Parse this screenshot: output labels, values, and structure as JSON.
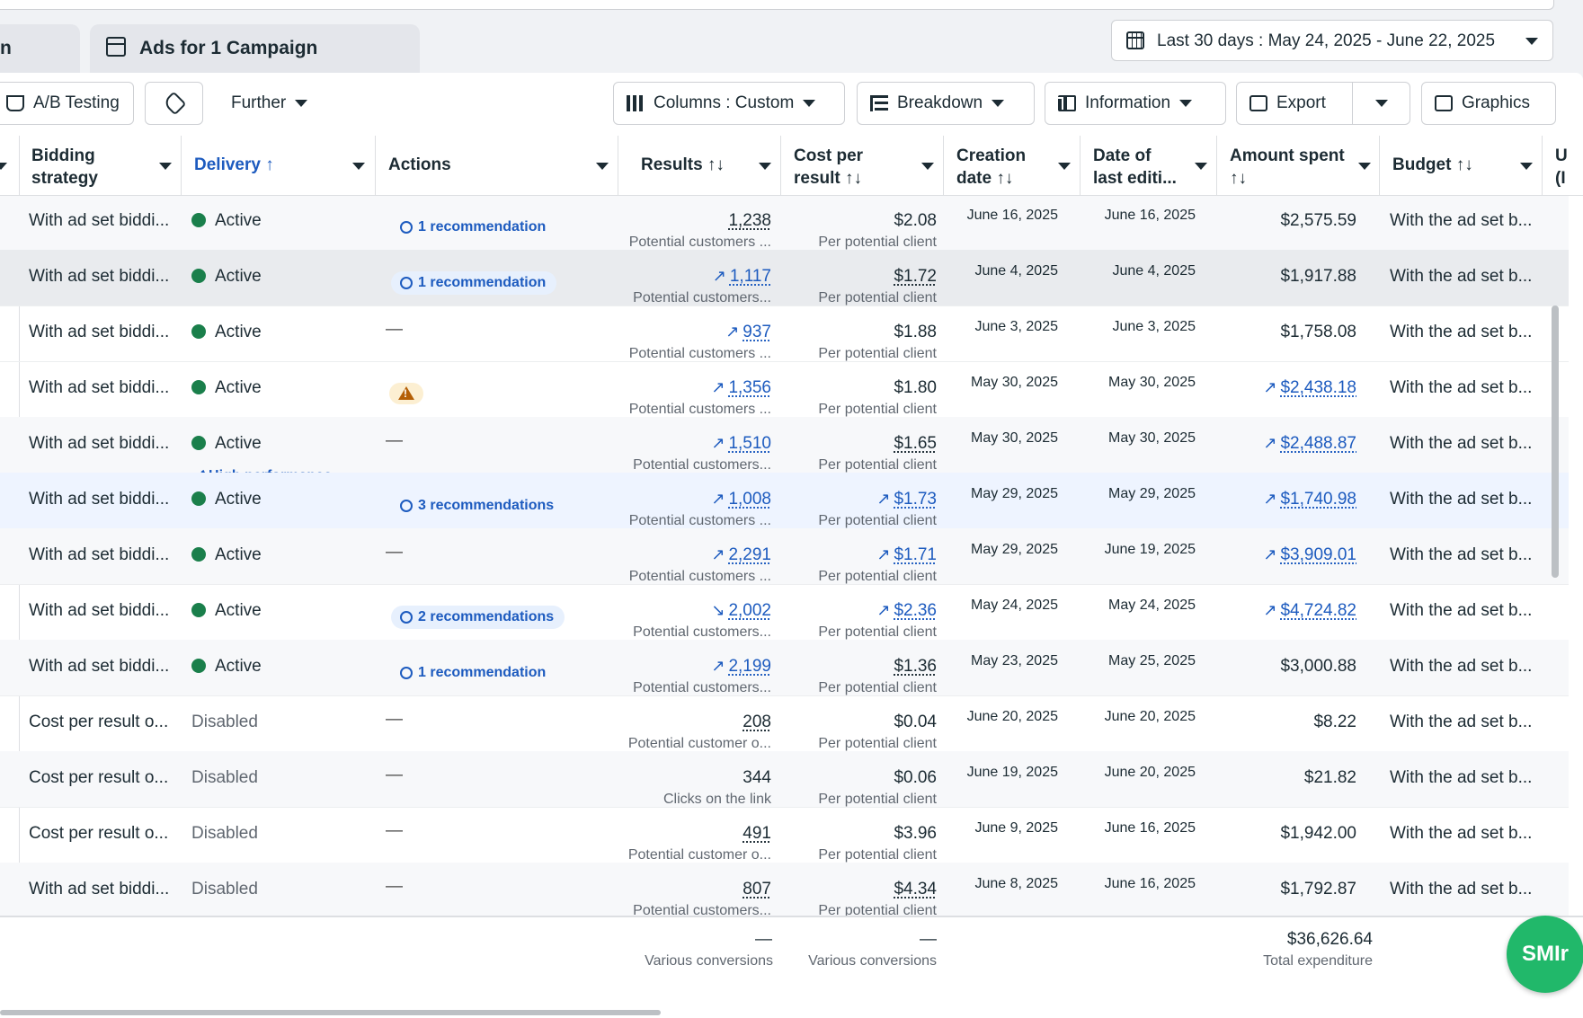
{
  "tabs": {
    "prev_tab_label": "n",
    "current_tab_label": "Ads for 1 Campaign"
  },
  "date_range": {
    "label": "Last 30 days : May 24, 2025 - June 22, 2025"
  },
  "toolbar": {
    "ab_testing": "A/B Testing",
    "further": "Further",
    "columns": "Columns : Custom",
    "breakdown": "Breakdown",
    "information": "Information",
    "export": "Export",
    "graphics": "Graphics"
  },
  "headers": {
    "bidding_1": "Bidding",
    "bidding_2": "strategy",
    "delivery": "Delivery",
    "actions": "Actions",
    "results": "Results",
    "cost_1": "Cost per",
    "cost_2": "result",
    "creation_1": "Creation",
    "creation_2": "date",
    "last_edit_1": "Date of",
    "last_edit_2": "last editi...",
    "amount_1": "Amount spent",
    "budget": "Budget",
    "cut_col": "U (I"
  },
  "rows": [
    {
      "bid": "With ad set biddi...",
      "delivery": "Active",
      "action": "1 recommendation",
      "action_type": "rec",
      "results": "1,238",
      "results_sub": "Potential customers ...",
      "cost": "$2.08",
      "cost_sub": "Per potential client",
      "created": "June 16, 2025",
      "edited": "June 16, 2025",
      "amount": "$2,575.59",
      "budget": "With the ad set b..."
    },
    {
      "bid": "With ad set biddi...",
      "delivery": "Active",
      "action": "1 recommendation",
      "action_type": "rec",
      "results": "1,117",
      "results_sub": "Potential customers...",
      "cost": "$1.72",
      "cost_sub": "Per potential client",
      "created": "June 4, 2025",
      "edited": "June 4, 2025",
      "amount": "$1,917.88",
      "budget": "With the ad set b..."
    },
    {
      "bid": "With ad set biddi...",
      "delivery": "Active",
      "action": "—",
      "action_type": "dash",
      "results": "937",
      "results_sub": "Potential customers ...",
      "cost": "$1.88",
      "cost_sub": "Per potential client",
      "created": "June 3, 2025",
      "edited": "June 3, 2025",
      "amount": "$1,758.08",
      "budget": "With the ad set b..."
    },
    {
      "bid": "With ad set biddi...",
      "delivery": "Active",
      "action": "",
      "action_type": "warn",
      "results": "1,356",
      "results_sub": "Potential customers ...",
      "cost": "$1.80",
      "cost_sub": "Per potential client",
      "created": "May 30, 2025",
      "edited": "May 30, 2025",
      "amount": "$2,438.18",
      "budget": "With the ad set b..."
    },
    {
      "bid": "With ad set biddi...",
      "delivery": "Active",
      "delivery_badge": "High performance",
      "action": "—",
      "action_type": "dash",
      "results": "1,510",
      "results_sub": "Potential customers...",
      "cost": "$1.65",
      "cost_sub": "Per potential client",
      "created": "May 30, 2025",
      "edited": "May 30, 2025",
      "amount": "$2,488.87",
      "budget": "With the ad set b..."
    },
    {
      "bid": "With ad set biddi...",
      "delivery": "Active",
      "action": "3 recommendations",
      "action_type": "rec",
      "results": "1,008",
      "results_sub": "Potential customers ...",
      "cost": "$1.73",
      "cost_sub": "Per potential client",
      "created": "May 29, 2025",
      "edited": "May 29, 2025",
      "amount": "$1,740.98",
      "budget": "With the ad set b..."
    },
    {
      "bid": "With ad set biddi...",
      "delivery": "Active",
      "action": "—",
      "action_type": "dash",
      "results": "2,291",
      "results_sub": "Potential customers ...",
      "cost": "$1.71",
      "cost_sub": "Per potential client",
      "created": "May 29, 2025",
      "edited": "June 19, 2025",
      "amount": "$3,909.01",
      "budget": "With the ad set b..."
    },
    {
      "bid": "With ad set biddi...",
      "delivery": "Active",
      "action": "2 recommendations",
      "action_type": "rec",
      "results": "2,002",
      "results_sub": "Potential customers...",
      "cost": "$2.36",
      "cost_sub": "Per potential client",
      "created": "May 24, 2025",
      "edited": "May 24, 2025",
      "amount": "$4,724.82",
      "budget": "With the ad set b..."
    },
    {
      "bid": "With ad set biddi...",
      "delivery": "Active",
      "action": "1 recommendation",
      "action_type": "rec",
      "results": "2,199",
      "results_sub": "Potential customers...",
      "cost": "$1.36",
      "cost_sub": "Per potential client",
      "created": "May 23, 2025",
      "edited": "May 25, 2025",
      "amount": "$3,000.88",
      "budget": "With the ad set b..."
    },
    {
      "bid": "Cost per result o...",
      "delivery": "Disabled",
      "action": "—",
      "action_type": "dash",
      "results": "208",
      "results_sub": "Potential customer o...",
      "cost": "$0.04",
      "cost_sub": "Per potential client",
      "created": "June 20, 2025",
      "edited": "June 20, 2025",
      "amount": "$8.22",
      "budget": "With the ad set b..."
    },
    {
      "bid": "Cost per result o...",
      "delivery": "Disabled",
      "action": "—",
      "action_type": "dash",
      "results": "344",
      "results_sub": "Clicks on the link",
      "cost": "$0.06",
      "cost_sub": "Per potential client",
      "created": "June 19, 2025",
      "edited": "June 20, 2025",
      "amount": "$21.82",
      "budget": "With the ad set b..."
    },
    {
      "bid": "Cost per result o...",
      "delivery": "Disabled",
      "action": "—",
      "action_type": "dash",
      "results": "491",
      "results_sub": "Potential customer o...",
      "cost": "$3.96",
      "cost_sub": "Per potential client",
      "created": "June 9, 2025",
      "edited": "June 16, 2025",
      "amount": "$1,942.00",
      "budget": "With the ad set b..."
    },
    {
      "bid": "With ad set biddi...",
      "delivery": "Disabled",
      "action": "—",
      "action_type": "dash",
      "results": "807",
      "results_sub": "Potential customers...",
      "cost": "$4.34",
      "cost_sub": "Per potential client",
      "created": "June 8, 2025",
      "edited": "June 16, 2025",
      "amount": "$1,792.87",
      "budget": "With the ad set b..."
    }
  ],
  "footer": {
    "results_value": "—",
    "results_sub": "Various conversions",
    "cost_value": "—",
    "cost_sub": "Various conversions",
    "amount_value": "$36,626.64",
    "amount_sub": "Total expenditure"
  },
  "fab_label": "SMIr",
  "colors": {
    "active_dot": "#1a7f4b",
    "link": "#1d5bbf",
    "fab": "#21b86a"
  }
}
